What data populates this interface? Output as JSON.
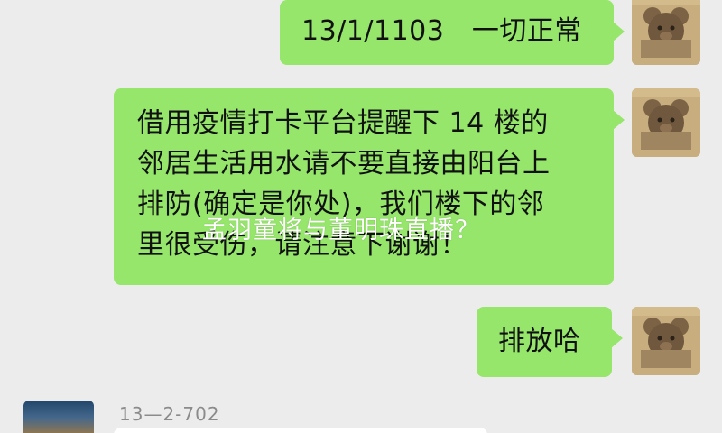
{
  "colors": {
    "background": "#ececec",
    "outgoing_bubble": "#95e66a",
    "incoming_bubble": "#ffffff",
    "name_text": "#8b8b8b",
    "overlay_text": "#ffffff"
  },
  "messages": [
    {
      "text": "13/1/1103　一切正常",
      "avatar_icon": "bear-avatar-icon"
    },
    {
      "lines": [
        "借用疫情打卡平台提醒下 14 楼的",
        "邻居生活用水请不要直接由阳台上",
        "排防(确定是你处)，我们楼下的邻",
        "里很受伤，请注意下谢谢！"
      ],
      "avatar_icon": "bear-avatar-icon"
    },
    {
      "text": "排放哈",
      "avatar_icon": "bear-avatar-icon"
    }
  ],
  "incoming": {
    "sender_name": "13—2-702",
    "avatar_icon": "landscape-avatar-icon"
  },
  "overlay_text": "孟羽童将与董明珠直播？"
}
